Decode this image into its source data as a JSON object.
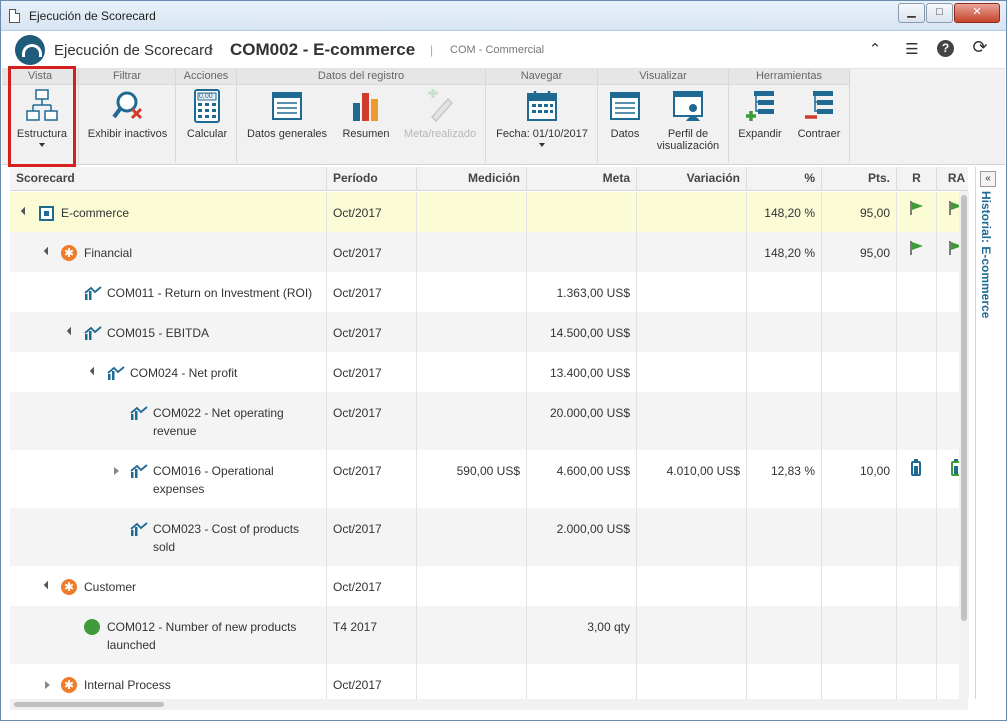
{
  "window": {
    "title": "Ejecución de Scorecard",
    "minimize": "▁",
    "maximize": "□",
    "close": "✕"
  },
  "header": {
    "app_name": "Ejecución de Scorecard",
    "separator": "›",
    "record_title": "COM002 - E-commerce",
    "divider": "|",
    "subtitle": "COM - Commercial",
    "icons": [
      "collapse-up-icon",
      "list-icon",
      "help-icon",
      "refresh-icon"
    ],
    "icon_glyphs": {
      "collapse": "⌃",
      "list": "☰",
      "help": "?",
      "refresh": "⟳"
    }
  },
  "ribbon": {
    "groups": [
      {
        "title": "Vista",
        "buttons": [
          {
            "label": "Estructura",
            "has_dropdown": true
          }
        ]
      },
      {
        "title": "Filtrar",
        "buttons": [
          {
            "label": "Exhibir inactivos"
          }
        ]
      },
      {
        "title": "Acciones",
        "buttons": [
          {
            "label": "Calcular"
          }
        ]
      },
      {
        "title": "Datos del registro",
        "buttons": [
          {
            "label": "Datos generales"
          },
          {
            "label": "Resumen"
          },
          {
            "label": "Meta/realizado",
            "disabled": true
          }
        ]
      },
      {
        "title": "Navegar",
        "buttons": [
          {
            "label": "Fecha: 01/10/2017",
            "has_dropdown": true
          }
        ]
      },
      {
        "title": "Visualizar",
        "buttons": [
          {
            "label": "Datos"
          },
          {
            "label": "Perfil de visualización"
          }
        ]
      },
      {
        "title": "Herramientas",
        "buttons": [
          {
            "label": "Expandir"
          },
          {
            "label": "Contraer"
          }
        ]
      }
    ],
    "calc_display": "0,00"
  },
  "table": {
    "columns": [
      "Scorecard",
      "Período",
      "Medición",
      "Meta",
      "Variación",
      "%",
      "Pts.",
      "R",
      "RA"
    ],
    "rows": [
      {
        "name": "E-commerce",
        "period": "Oct/2017",
        "medicion": "",
        "meta": "",
        "variacion": "",
        "pct": "148,20 %",
        "pts": "95,00",
        "r": "flag",
        "ra": "flag"
      },
      {
        "name": "Financial",
        "period": "Oct/2017",
        "medicion": "",
        "meta": "",
        "variacion": "",
        "pct": "148,20 %",
        "pts": "95,00",
        "r": "flag",
        "ra": "flag"
      },
      {
        "name": "COM011 - Return on Investment (ROI)",
        "period": "Oct/2017",
        "medicion": "",
        "meta": "1.363,00 US$",
        "variacion": "",
        "pct": "",
        "pts": ""
      },
      {
        "name": "COM015 - EBITDA",
        "period": "Oct/2017",
        "medicion": "",
        "meta": "14.500,00 US$",
        "variacion": "",
        "pct": "",
        "pts": ""
      },
      {
        "name": "COM024 - Net profit",
        "period": "Oct/2017",
        "medicion": "",
        "meta": "13.400,00 US$",
        "variacion": "",
        "pct": "",
        "pts": ""
      },
      {
        "name": "COM022 - Net operating revenue",
        "period": "Oct/2017",
        "medicion": "",
        "meta": "20.000,00 US$",
        "variacion": "",
        "pct": "",
        "pts": ""
      },
      {
        "name": "COM016 - Operational expenses",
        "period": "Oct/2017",
        "medicion": "590,00 US$",
        "meta": "4.600,00 US$",
        "variacion": "4.010,00 US$",
        "pct": "12,83 %",
        "pts": "10,00",
        "r": "battery",
        "ra": "battery"
      },
      {
        "name": "COM023 - Cost of products sold",
        "period": "Oct/2017",
        "medicion": "",
        "meta": "2.000,00 US$",
        "variacion": "",
        "pct": "",
        "pts": ""
      },
      {
        "name": "Customer",
        "period": "Oct/2017",
        "medicion": "",
        "meta": "",
        "variacion": "",
        "pct": "",
        "pts": ""
      },
      {
        "name": "COM012 - Number of new products launched",
        "period": "T4 2017",
        "medicion": "",
        "meta": "3,00 qty",
        "variacion": "",
        "pct": "",
        "pts": ""
      },
      {
        "name": "Internal Process",
        "period": "Oct/2017",
        "medicion": "",
        "meta": "",
        "variacion": "",
        "pct": "",
        "pts": ""
      }
    ]
  },
  "side_panel": {
    "label": "Historial: E-commerce",
    "toggle": "«"
  },
  "colors": {
    "accent": "#1f6a93",
    "perspective": "#ef7b2c",
    "flag": "#3f9a3a",
    "selected_row": "#fbfbd6",
    "highlight": "#d81f1f"
  }
}
